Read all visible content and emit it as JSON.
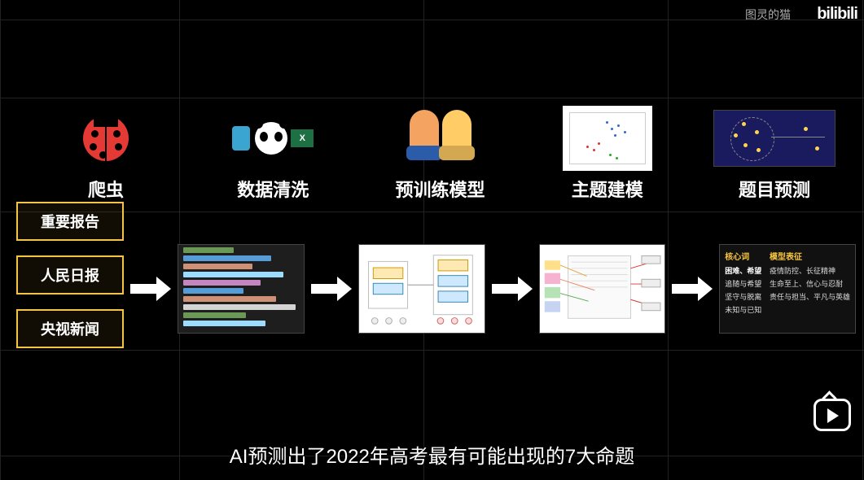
{
  "watermark": {
    "channel": "图灵的猫",
    "site": "bilibili"
  },
  "stages": {
    "s1": "爬虫",
    "s2": "数据清洗",
    "s3": "预训练模型",
    "s4": "主题建模",
    "s5": "题目预测"
  },
  "sources": {
    "a": "重要报告",
    "b": "人民日报",
    "c": "央视新闻"
  },
  "output_panel": {
    "left_header": "核心词",
    "left_sub": "困难、希望",
    "left_lines": [
      "追随与希望",
      "坚守与脱离",
      "未知与已知"
    ],
    "right_header": "模型表征",
    "right_lines": [
      "疫情防控、长征精神",
      "生命至上、信心与忍耐",
      "责任与担当、平凡与英雄"
    ]
  },
  "subtitle": "AI预测出了2022年高考最有可能出现的7大命题",
  "icons": {
    "excel_label": "X"
  }
}
